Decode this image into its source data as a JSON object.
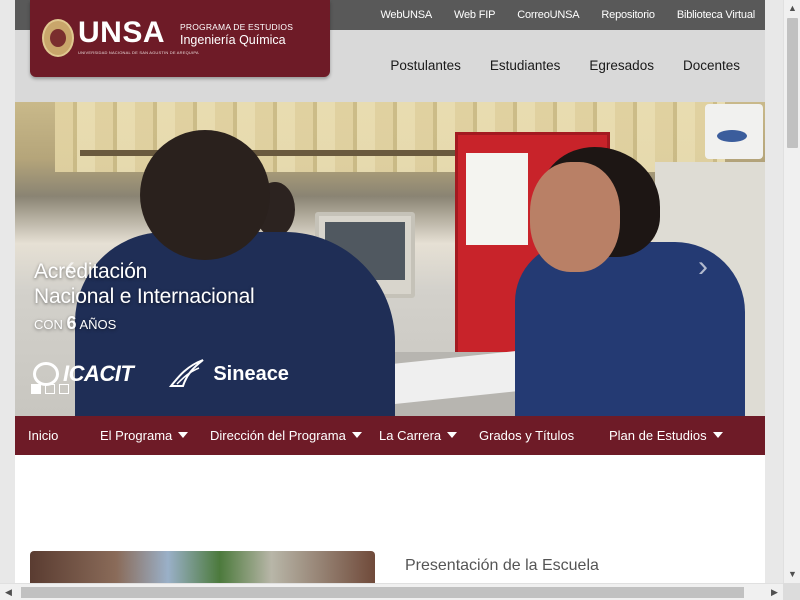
{
  "toplinks": [
    "WebUNSA",
    "Web FIP",
    "CorreoUNSA",
    "Repositorio",
    "Biblioteca Virtual"
  ],
  "logo": {
    "name": "UNSA",
    "subtitle": "UNIVERSIDAD NACIONAL DE SAN AGUSTIN DE AREQUIPA",
    "program_small": "PROGRAMA DE ESTUDIOS",
    "program_name": "Ingeniería Química"
  },
  "mainnav": [
    "Postulantes",
    "Estudiantes",
    "Egresados",
    "Docentes"
  ],
  "hero": {
    "line1": "Acreditación",
    "line2": "Nacional e Internacional",
    "line3_prefix": "CON",
    "line3_number": "6",
    "line3_suffix": "AÑOS",
    "logo1": "ICACIT",
    "logo2": "Sineace",
    "slides": 3,
    "active_slide": 0
  },
  "prognav": {
    "items": [
      {
        "label": "Inicio",
        "dropdown": false
      },
      {
        "label": "El Programa",
        "dropdown": true
      },
      {
        "label": "Dirección del Programa",
        "dropdown": true
      },
      {
        "label": "La Carrera",
        "dropdown": true
      },
      {
        "label": "Grados y Títulos",
        "dropdown": false
      },
      {
        "label": "Plan de Estudios",
        "dropdown": true
      }
    ]
  },
  "section": {
    "title": "Presentación de la Escuela"
  },
  "colors": {
    "brand": "#6e1b27",
    "topbar": "#595959",
    "header": "#d9d9d9"
  }
}
